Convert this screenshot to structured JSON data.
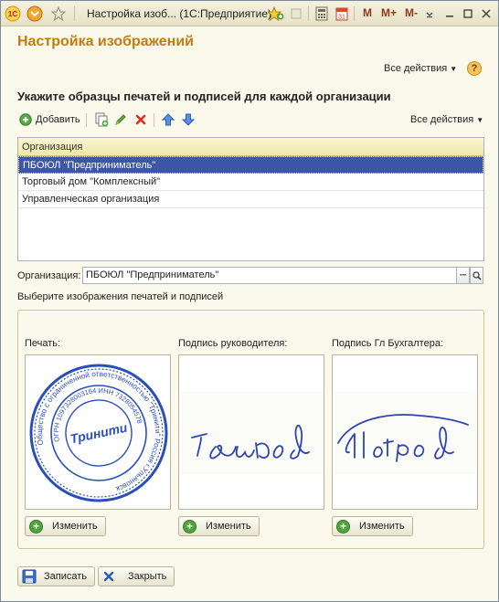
{
  "window": {
    "title": "Настройка изоб...  (1С:Предприятие)",
    "calc_m": "M",
    "calc_mplus": "M+",
    "calc_mminus": "M-"
  },
  "form": {
    "title": "Настройка изображений",
    "all_actions": "Все действия",
    "help": "?",
    "subtitle": "Укажите образцы печатей и подписей для каждой организации"
  },
  "toolbar": {
    "add_label": "Добавить",
    "all_actions": "Все действия"
  },
  "table": {
    "header": "Организация",
    "rows": [
      "ПБОЮЛ \"Предприниматель\"",
      "Торговый дом \"Комплексный\"",
      "Управленческая организация"
    ],
    "selected_index": 0
  },
  "org_field": {
    "label": "Организация:",
    "value": "ПБОЮЛ \"Предприниматель\""
  },
  "images": {
    "section_label": "Выберите изображения печатей и подписей",
    "stamp_label": "Печать:",
    "director_label": "Подпись руководителя:",
    "accountant_label": "Подпись Гл Бухгалтера:",
    "change_label": "Изменить",
    "stamp": {
      "outer_text": "Общество с ограниченной ответственностью \"Тринити\" Россия г.Ульяновск",
      "inner_text": "ОГРН 1097328003164   ИНН 7328054578",
      "center_text": "Тринити"
    }
  },
  "footer": {
    "save_label": "Записать",
    "close_label": "Закрыть"
  },
  "colors": {
    "title": "#c07c0f",
    "selection": "#3d56a9",
    "stamp": "#2a4fb8",
    "signature": "#2c43b0"
  }
}
